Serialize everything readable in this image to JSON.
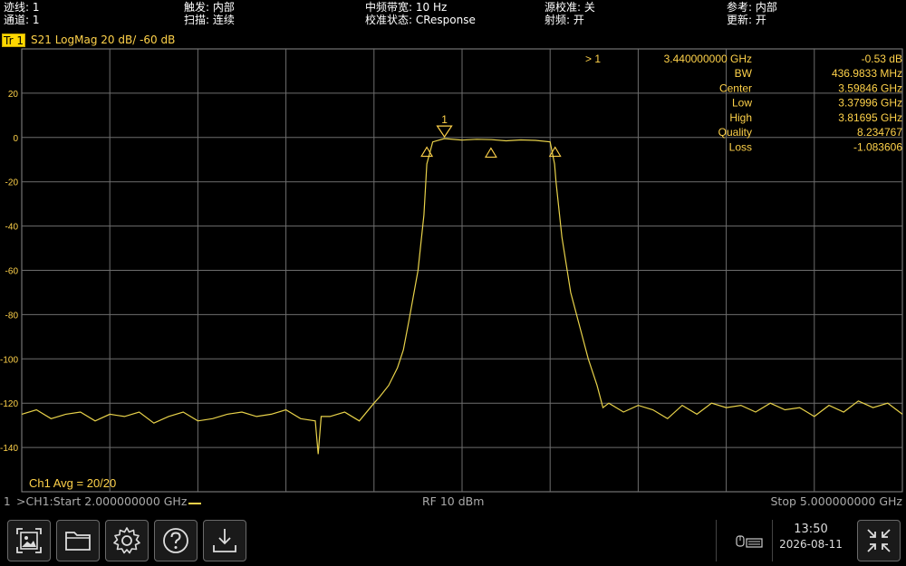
{
  "status": {
    "trace": "迹线: 1",
    "channel": "通道: 1",
    "trigger": "触发: 内部",
    "sweep": "扫描: 连续",
    "ifbw": "中频带宽: 10 Hz",
    "cal": "校准状态: CResponse",
    "source_cal": "源校准: 关",
    "rf": "射频: 开",
    "reference": "参考: 内部",
    "update": "更新: 开"
  },
  "trace": {
    "tab": "Tr 1",
    "desc": "S21  LogMag  20 dB/  -60 dB"
  },
  "marker": {
    "row_label": "> 1",
    "row_freq": "3.440000000 GHz",
    "row_value": "-0.53 dB",
    "label": "1",
    "stats": [
      {
        "label": "BW",
        "value": "436.9833 MHz"
      },
      {
        "label": "Center",
        "value": "3.59846 GHz"
      },
      {
        "label": "Low",
        "value": "3.37996 GHz"
      },
      {
        "label": "High",
        "value": "3.81695 GHz"
      },
      {
        "label": "Quality",
        "value": "8.234767"
      },
      {
        "label": "Loss",
        "value": "-1.083606"
      }
    ]
  },
  "avg": "Ch1 Avg = 20/20",
  "channel_bar": {
    "index": "1",
    "start": ">CH1:Start 2.000000000 GHz",
    "power": "RF 10 dBm",
    "stop": "Stop 5.000000000 GHz"
  },
  "clock": {
    "time": "13:50",
    "date": "2026-08-11"
  },
  "toolbar": {
    "icons": [
      "screenshot-icon",
      "folder-icon",
      "gear-icon",
      "help-icon",
      "download-icon",
      "keyboard-mouse-icon",
      "collapse-arrows-icon"
    ]
  },
  "chart_data": {
    "type": "line",
    "x_unit": "GHz",
    "xlim": [
      2.0,
      5.0
    ],
    "ylim": [
      -160,
      40
    ],
    "yticks": [
      20,
      0,
      -20,
      -40,
      -60,
      -80,
      -100,
      -120,
      -140
    ],
    "ytick_labels": [
      "20",
      "0",
      "-20",
      "-40",
      "-60",
      "-80",
      "-100",
      "-120",
      "-140"
    ],
    "grid": true,
    "color": "#e8d24a",
    "series": [
      {
        "x": [
          2.0,
          2.05,
          2.1,
          2.15,
          2.2,
          2.25,
          2.3,
          2.35,
          2.4,
          2.45,
          2.5,
          2.55,
          2.6,
          2.65,
          2.7,
          2.75,
          2.8,
          2.85,
          2.9,
          2.95,
          3.0,
          3.01,
          3.02,
          3.05,
          3.1,
          3.15,
          3.2,
          3.22,
          3.25,
          3.28,
          3.3,
          3.32,
          3.35,
          3.37,
          3.38,
          3.4,
          3.44,
          3.5,
          3.55,
          3.6,
          3.65,
          3.7,
          3.75,
          3.8,
          3.815,
          3.82,
          3.84,
          3.87,
          3.9,
          3.93,
          3.96,
          3.98,
          4.0,
          4.05,
          4.1,
          4.15,
          4.2,
          4.25,
          4.3,
          4.35,
          4.4,
          4.45,
          4.5,
          4.55,
          4.6,
          4.65,
          4.7,
          4.75,
          4.8,
          4.85,
          4.9,
          4.95,
          5.0
        ],
        "y": [
          -125,
          -123,
          -127,
          -125,
          -124,
          -128,
          -125,
          -126,
          -124,
          -129,
          -126,
          -124,
          -128,
          -127,
          -125,
          -124,
          -126,
          -125,
          -123,
          -127,
          -128,
          -143,
          -126,
          -126,
          -124,
          -128,
          -120,
          -117,
          -112,
          -104,
          -96,
          -82,
          -60,
          -35,
          -12,
          -2,
          -0.5,
          -1.2,
          -0.8,
          -1.0,
          -1.5,
          -1.1,
          -1.3,
          -2,
          -12,
          -20,
          -45,
          -70,
          -85,
          -100,
          -112,
          -122,
          -120,
          -124,
          -121,
          -123,
          -127,
          -121,
          -125,
          -120,
          -122,
          -121,
          -124,
          -120,
          -123,
          -122,
          -126,
          -121,
          -124,
          -119,
          -122,
          -120,
          -125
        ]
      }
    ],
    "markers": [
      {
        "name": "1",
        "x": 3.44,
        "y": -0.53,
        "type": "active"
      },
      {
        "name": "low",
        "x": 3.37996,
        "y": -3.6,
        "type": "bw"
      },
      {
        "name": "center",
        "x": 3.59846,
        "y": -4.0,
        "type": "bw"
      },
      {
        "name": "high",
        "x": 3.81695,
        "y": -3.6,
        "type": "bw"
      }
    ]
  }
}
